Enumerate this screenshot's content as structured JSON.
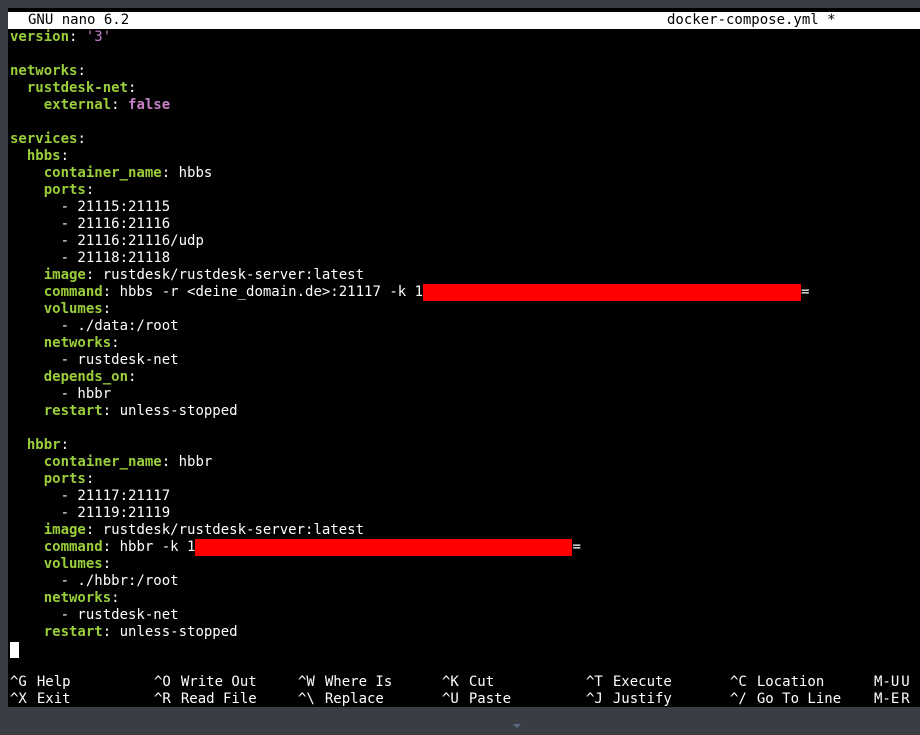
{
  "titlebar": {
    "app": "GNU nano 6.2",
    "file": "docker-compose.yml *"
  },
  "editor": {
    "version": {
      "key": "version",
      "value": "'3'"
    },
    "networks_key": "networks",
    "net_name": "rustdesk-net",
    "external": {
      "key": "external",
      "value": "false"
    },
    "services_key": "services",
    "hbbs": {
      "name": "hbbs",
      "container_name": {
        "key": "container_name",
        "value": "hbbs"
      },
      "ports_key": "ports",
      "ports": [
        "- 21115:21115",
        "- 21116:21116",
        "- 21116:21116/udp",
        "- 21118:21118"
      ],
      "image": {
        "key": "image",
        "value": "rustdesk/rustdesk-server:latest"
      },
      "command": {
        "key": "command",
        "value": "hbbs -r <deine_domain.de>:21117 -k 1",
        "suffix": "="
      },
      "volumes_key": "volumes",
      "volume": "- ./data:/root",
      "networks_key": "networks",
      "network": "- rustdesk-net",
      "depends_key": "depends_on",
      "depends": "- hbbr",
      "restart": {
        "key": "restart",
        "value": "unless-stopped"
      }
    },
    "hbbr": {
      "name": "hbbr",
      "container_name": {
        "key": "container_name",
        "value": "hbbr"
      },
      "ports_key": "ports",
      "ports": [
        "- 21117:21117",
        "- 21119:21119"
      ],
      "image": {
        "key": "image",
        "value": "rustdesk/rustdesk-server:latest"
      },
      "command": {
        "key": "command",
        "value": "hbbr -k 1",
        "suffix": "="
      },
      "volumes_key": "volumes",
      "volume": "- ./hbbr:/root",
      "networks_key": "networks",
      "network": "- rustdesk-net",
      "restart": {
        "key": "restart",
        "value": "unless-stopped"
      }
    }
  },
  "shortcuts": [
    {
      "key": "^G",
      "label": "Help"
    },
    {
      "key": "^X",
      "label": "Exit"
    },
    {
      "key": "^O",
      "label": "Write Out"
    },
    {
      "key": "^R",
      "label": "Read File"
    },
    {
      "key": "^W",
      "label": "Where Is"
    },
    {
      "key": "^\\",
      "label": "Replace"
    },
    {
      "key": "^K",
      "label": "Cut"
    },
    {
      "key": "^U",
      "label": "Paste"
    },
    {
      "key": "^T",
      "label": "Execute"
    },
    {
      "key": "^J",
      "label": "Justify"
    },
    {
      "key": "^C",
      "label": "Location"
    },
    {
      "key": "^/",
      "label": "Go To Line"
    },
    {
      "key": "M-U",
      "label": "U"
    },
    {
      "key": "M-E",
      "label": "R"
    }
  ],
  "colors": {
    "key": "#9ace3a",
    "string": "#c77fc6",
    "redaction": "#ff0000",
    "background": "#000000"
  }
}
